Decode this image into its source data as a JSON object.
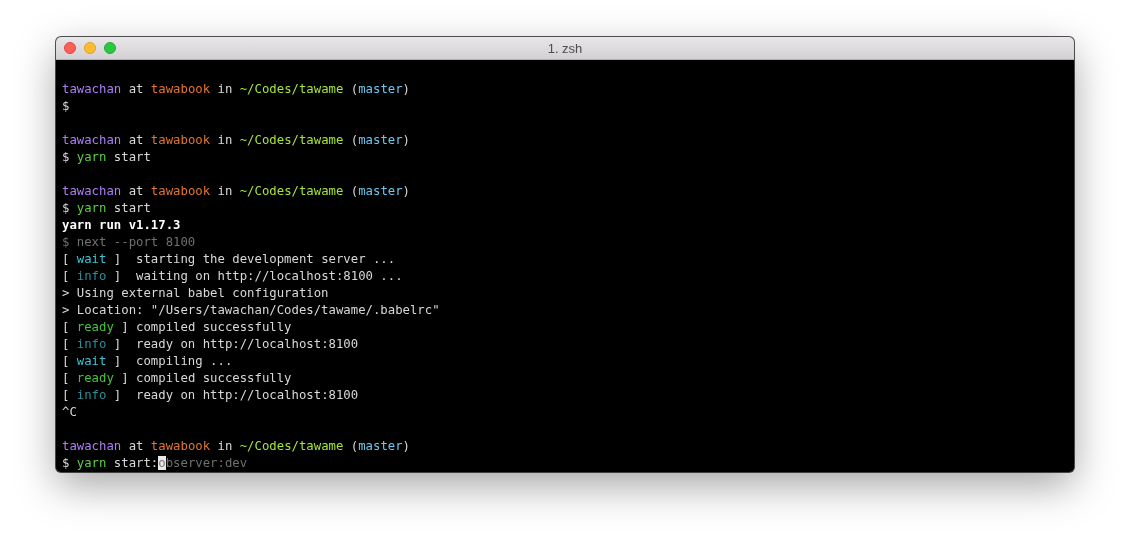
{
  "window": {
    "title": "1. zsh"
  },
  "blocks": [
    {
      "lines": [
        {
          "segments": [
            {
              "kind": "user",
              "text": "tawachan"
            },
            {
              "kind": "plain",
              "text": " at "
            },
            {
              "kind": "host",
              "text": "tawabook"
            },
            {
              "kind": "plain",
              "text": " in "
            },
            {
              "kind": "path",
              "text": "~/Codes/tawame"
            },
            {
              "kind": "plain",
              "text": " ("
            },
            {
              "kind": "branch",
              "text": "master"
            },
            {
              "kind": "plain",
              "text": ")"
            }
          ]
        },
        {
          "segments": [
            {
              "kind": "plain",
              "text": "$"
            }
          ]
        }
      ]
    },
    {
      "lines": [
        {
          "segments": [
            {
              "kind": "user",
              "text": "tawachan"
            },
            {
              "kind": "plain",
              "text": " at "
            },
            {
              "kind": "host",
              "text": "tawabook"
            },
            {
              "kind": "plain",
              "text": " in "
            },
            {
              "kind": "path",
              "text": "~/Codes/tawame"
            },
            {
              "kind": "plain",
              "text": " ("
            },
            {
              "kind": "branch",
              "text": "master"
            },
            {
              "kind": "plain",
              "text": ")"
            }
          ]
        },
        {
          "segments": [
            {
              "kind": "plain",
              "text": "$ "
            },
            {
              "kind": "command",
              "text": "yarn"
            },
            {
              "kind": "plain",
              "text": " start"
            }
          ]
        }
      ]
    },
    {
      "lines": [
        {
          "segments": [
            {
              "kind": "user",
              "text": "tawachan"
            },
            {
              "kind": "plain",
              "text": " at "
            },
            {
              "kind": "host",
              "text": "tawabook"
            },
            {
              "kind": "plain",
              "text": " in "
            },
            {
              "kind": "path",
              "text": "~/Codes/tawame"
            },
            {
              "kind": "plain",
              "text": " ("
            },
            {
              "kind": "branch",
              "text": "master"
            },
            {
              "kind": "plain",
              "text": ")"
            }
          ]
        },
        {
          "segments": [
            {
              "kind": "plain",
              "text": "$ "
            },
            {
              "kind": "command",
              "text": "yarn"
            },
            {
              "kind": "plain",
              "text": " start"
            }
          ]
        },
        {
          "segments": [
            {
              "kind": "bold",
              "text": "yarn run v1.17.3"
            }
          ]
        },
        {
          "segments": [
            {
              "kind": "dim",
              "text": "$ next --port 8100"
            }
          ]
        },
        {
          "segments": [
            {
              "kind": "plain",
              "text": "[ "
            },
            {
              "kind": "wait",
              "text": "wait"
            },
            {
              "kind": "plain",
              "text": " ]  starting the development server ..."
            }
          ]
        },
        {
          "segments": [
            {
              "kind": "plain",
              "text": "[ "
            },
            {
              "kind": "info",
              "text": "info"
            },
            {
              "kind": "plain",
              "text": " ]  waiting on http://localhost:8100 ..."
            }
          ]
        },
        {
          "segments": [
            {
              "kind": "plain",
              "text": "> Using external babel configuration"
            }
          ]
        },
        {
          "segments": [
            {
              "kind": "plain",
              "text": "> Location: \"/Users/tawachan/Codes/tawame/.babelrc\""
            }
          ]
        },
        {
          "segments": [
            {
              "kind": "plain",
              "text": "[ "
            },
            {
              "kind": "ready",
              "text": "ready"
            },
            {
              "kind": "plain",
              "text": " ] compiled successfully"
            }
          ]
        },
        {
          "segments": [
            {
              "kind": "plain",
              "text": "[ "
            },
            {
              "kind": "info",
              "text": "info"
            },
            {
              "kind": "plain",
              "text": " ]  ready on http://localhost:8100"
            }
          ]
        },
        {
          "segments": [
            {
              "kind": "plain",
              "text": "[ "
            },
            {
              "kind": "wait",
              "text": "wait"
            },
            {
              "kind": "plain",
              "text": " ]  compiling ..."
            }
          ]
        },
        {
          "segments": [
            {
              "kind": "plain",
              "text": "[ "
            },
            {
              "kind": "ready",
              "text": "ready"
            },
            {
              "kind": "plain",
              "text": " ] compiled successfully"
            }
          ]
        },
        {
          "segments": [
            {
              "kind": "plain",
              "text": "[ "
            },
            {
              "kind": "info",
              "text": "info"
            },
            {
              "kind": "plain",
              "text": " ]  ready on http://localhost:8100"
            }
          ]
        },
        {
          "segments": [
            {
              "kind": "plain",
              "text": "^C"
            }
          ]
        }
      ]
    },
    {
      "lines": [
        {
          "segments": [
            {
              "kind": "user",
              "text": "tawachan"
            },
            {
              "kind": "plain",
              "text": " at "
            },
            {
              "kind": "host",
              "text": "tawabook"
            },
            {
              "kind": "plain",
              "text": " in "
            },
            {
              "kind": "path",
              "text": "~/Codes/tawame"
            },
            {
              "kind": "plain",
              "text": " ("
            },
            {
              "kind": "branch",
              "text": "master"
            },
            {
              "kind": "plain",
              "text": ")"
            }
          ]
        },
        {
          "segments": [
            {
              "kind": "plain",
              "text": "$ "
            },
            {
              "kind": "command",
              "text": "yarn"
            },
            {
              "kind": "plain",
              "text": " start:"
            },
            {
              "kind": "cursor",
              "text": "o"
            },
            {
              "kind": "dim",
              "text": "bserver:dev"
            }
          ]
        }
      ]
    }
  ]
}
